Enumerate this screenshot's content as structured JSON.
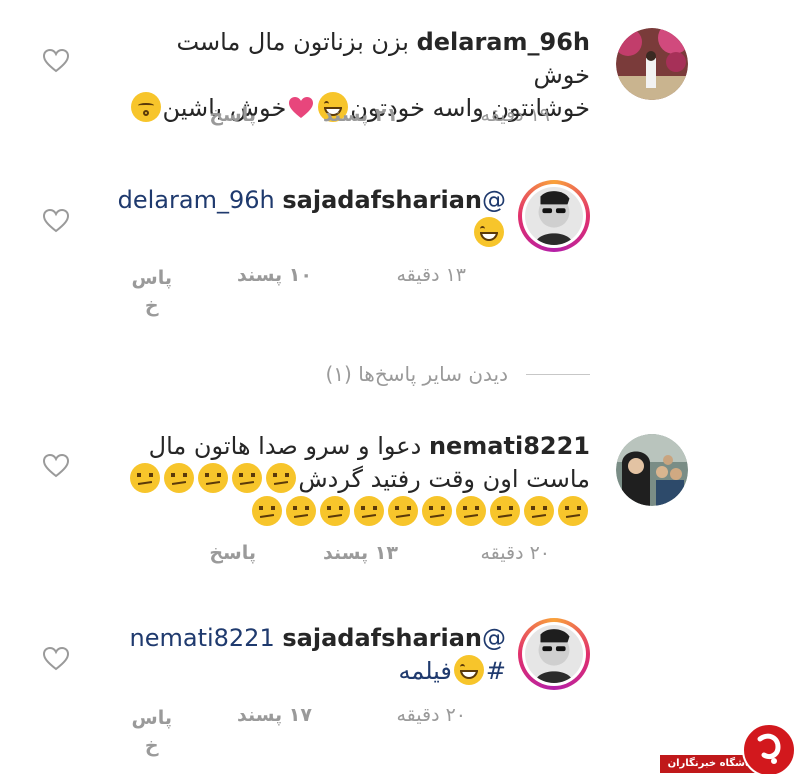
{
  "comments": [
    {
      "username": "delaram_96h",
      "line1": "بزن بزناتون مال ماست خوش",
      "line2": "خوشانتون واسه خودتون",
      "line2_end": "خوش باشین",
      "time": "۱۹ دقیقه",
      "likes": "۲۱ پسند",
      "reply": "پاسخ"
    },
    {
      "username": "sajadafsharian",
      "mention": "@delaram_96h",
      "time": "۱۳ دقیقه",
      "likes": "۱۰ پسند",
      "reply_a": "پاس",
      "reply_b": "خ"
    },
    {
      "username": "nemati8221",
      "line1": "دعوا و سرو صدا هاتون مال",
      "line2": "ماست اون وقت رفتید گردش",
      "time": "۲۰ دقیقه",
      "likes": "۱۳ پسند",
      "reply": "پاسخ"
    },
    {
      "username": "sajadafsharian",
      "mention": "@nemati8221",
      "hashtag": "#",
      "hashtag_word": "فیلمه",
      "time": "۲۰ دقیقه",
      "likes": "۱۷ پسند",
      "reply_a": "پاس",
      "reply_b": "خ"
    }
  ],
  "view_more": "دیدن سایر پاسخ‌ها (۱)",
  "watermark_text": "باشگاه خبرنگاران",
  "colors": {
    "accent_mention": "#1f3a6e",
    "muted": "#9a9a9a",
    "emoji": "#f7c52b",
    "heart": "#e8467c",
    "watermark": "#d2181d"
  },
  "icons": [
    "heart-outline-icon",
    "laughing-emoji-icon",
    "meh-emoji-icon",
    "pink-heart-emoji-icon",
    "kiss-emoji-icon"
  ]
}
